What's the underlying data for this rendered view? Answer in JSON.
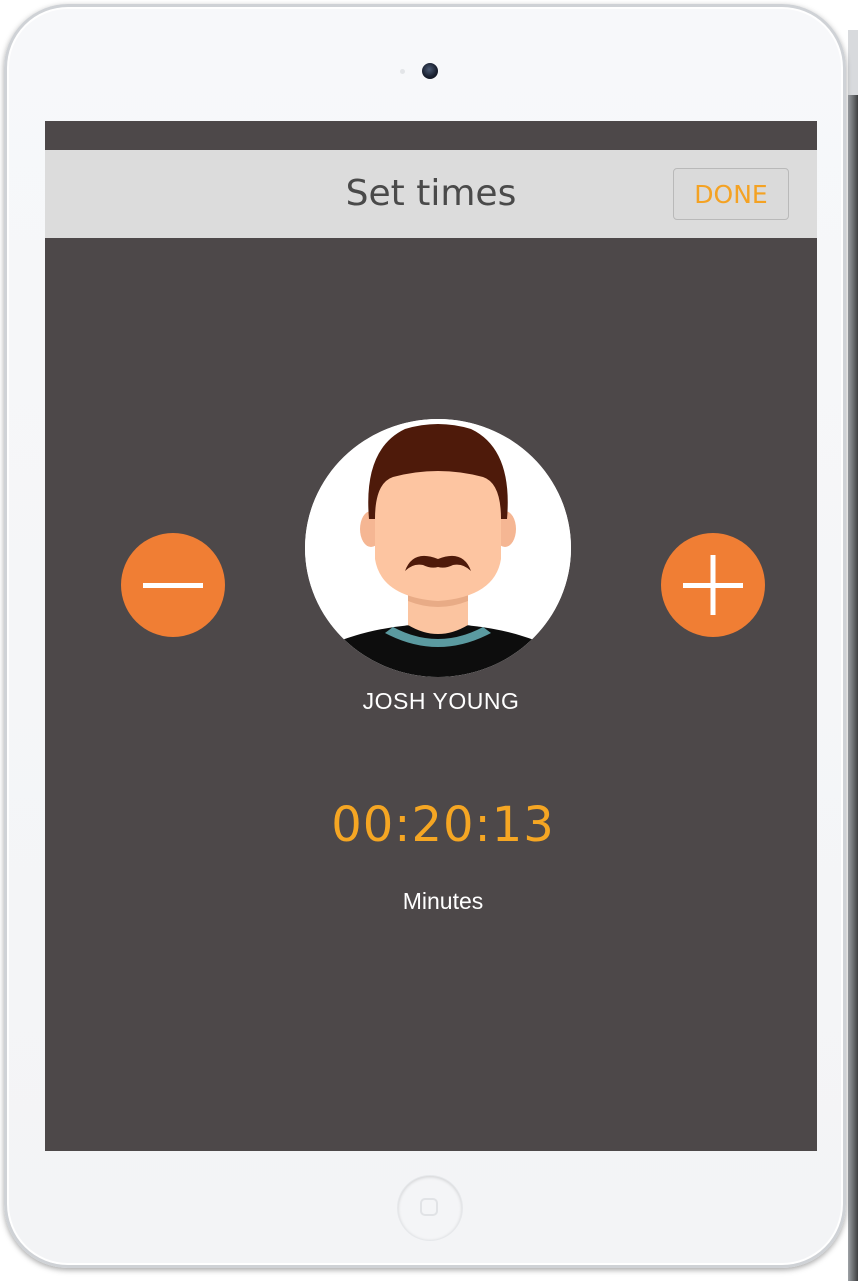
{
  "header": {
    "title": "Set times",
    "done_label": "DONE"
  },
  "controls": {
    "decrease_icon": "minus-icon",
    "increase_icon": "plus-icon"
  },
  "person": {
    "name": "JOSH YOUNG",
    "avatar_icon": "avatar-icon"
  },
  "timer": {
    "value": "00:20:13",
    "unit_label": "Minutes"
  },
  "colors": {
    "accent": "#f5a623",
    "button_orange": "#f07e34",
    "screen_background": "#4d4849",
    "header_background": "#dcdcdc"
  }
}
